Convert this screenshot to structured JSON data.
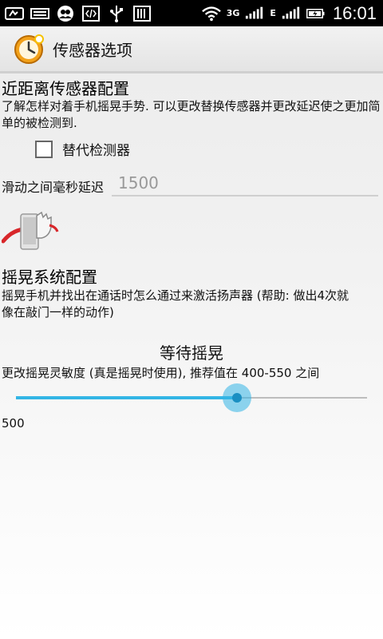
{
  "status_bar": {
    "network_3g": "3G",
    "network_e": "E",
    "time": "16:01",
    "left_icons": [
      "message-icon",
      "keyboard-icon",
      "contacts-icon",
      "code-icon",
      "usb-icon",
      "barcode-icon"
    ]
  },
  "action_bar": {
    "title": "传感器选项",
    "icon": "alarm-clock-icon"
  },
  "proximity": {
    "title": "近距离传感器配置",
    "description": "了解怎样对着手机摇晃手势. 可以更改替换传感器并更改延迟使之更加简单的被检测到.",
    "checkbox_label": "替代检测器",
    "checkbox_checked": false,
    "delay_label": "滑动之间毫秒延迟",
    "delay_value": "1500"
  },
  "shake": {
    "title": "摇晃系统配置",
    "description": "摇晃手机并找出在通话时怎么通过来激活扬声器 (帮助: 做出4次就像在敲门一样的动作)",
    "status": "等待摇晃",
    "sensitivity_label": "更改摇晃灵敏度 (真是摇晃时使用), 推荐值在 400-550 之间",
    "slider_fraction": 0.63,
    "value": "500"
  },
  "colors": {
    "accent": "#33b5e5",
    "track": "#bdbdbd"
  }
}
